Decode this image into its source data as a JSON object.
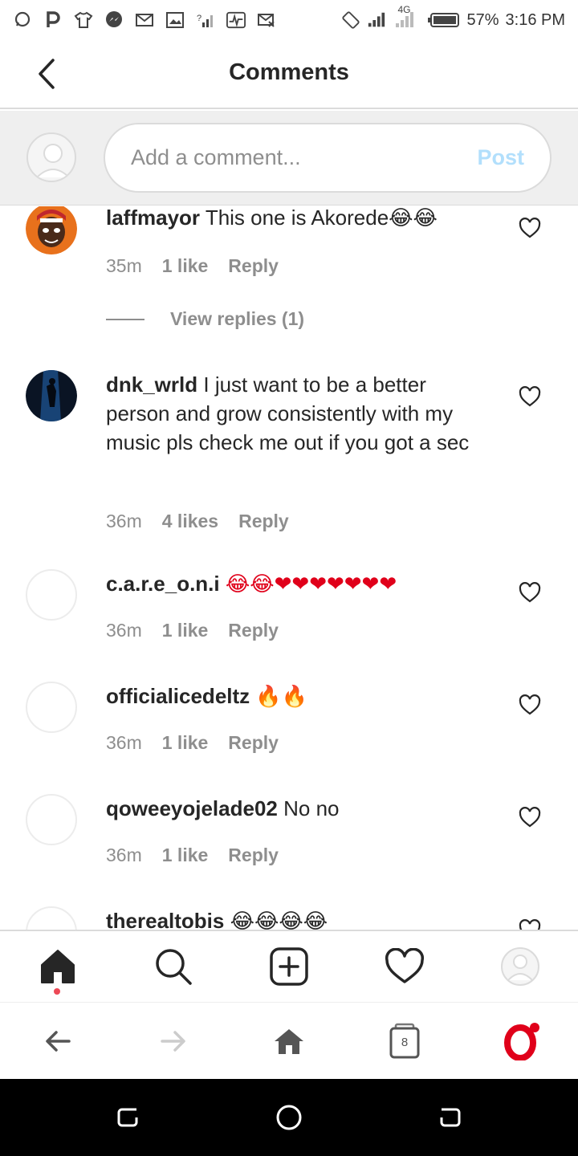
{
  "status_bar": {
    "network": "4G",
    "battery": "57%",
    "time": "3:16 PM"
  },
  "header": {
    "title": "Comments"
  },
  "composer": {
    "placeholder": "Add a comment...",
    "post_label": "Post"
  },
  "comments": [
    {
      "username": "laffmayor",
      "text": "This one is Akorede😂😂",
      "time": "35m",
      "likes": "1 like",
      "reply_label": "Reply",
      "view_replies": "View replies (1)"
    },
    {
      "username": "dnk_wrld",
      "text": "I just want to be a better person and grow consistently with my music pls check me out if you got a sec",
      "time": "36m",
      "likes": "4 likes",
      "reply_label": "Reply"
    },
    {
      "username": "c.a.r.e_o.n.i",
      "text": "😂😂❤❤❤❤❤❤❤",
      "time": "36m",
      "likes": "1 like",
      "reply_label": "Reply"
    },
    {
      "username": "officialicedeltz",
      "text": "🔥🔥",
      "time": "36m",
      "likes": "1 like",
      "reply_label": "Reply"
    },
    {
      "username": "qoweeyojelade02",
      "text": "No no",
      "time": "36m",
      "likes": "1 like",
      "reply_label": "Reply"
    },
    {
      "username": "therealtobis",
      "text": "😂😂😂😂"
    }
  ],
  "browser_bar": {
    "tab_count": "8"
  },
  "colors": {
    "accent_blue_disabled": "#b2dffc",
    "text_primary": "#262626",
    "text_secondary": "#8e8e8e",
    "opera_red": "#e0001a",
    "notification_dot": "#ed4956"
  },
  "icons": {
    "status_left": [
      "chat-bubble-icon",
      "p-app-icon",
      "tshirt-icon",
      "messenger-icon",
      "gmail-icon",
      "gallery-icon",
      "signal-unknown-icon",
      "pulse-icon",
      "mail-off-icon"
    ],
    "status_right": [
      "rotate-icon",
      "signal-icon",
      "4g-signal-icon",
      "battery-icon"
    ],
    "ig_nav": [
      "home-icon",
      "search-icon",
      "add-post-icon",
      "heart-icon",
      "profile-avatar"
    ],
    "browser_nav": [
      "back-arrow-icon",
      "forward-arrow-icon",
      "home-icon",
      "tabs-icon",
      "opera-icon"
    ],
    "android_nav": [
      "recents-icon",
      "home-circle-icon",
      "back-icon"
    ]
  }
}
